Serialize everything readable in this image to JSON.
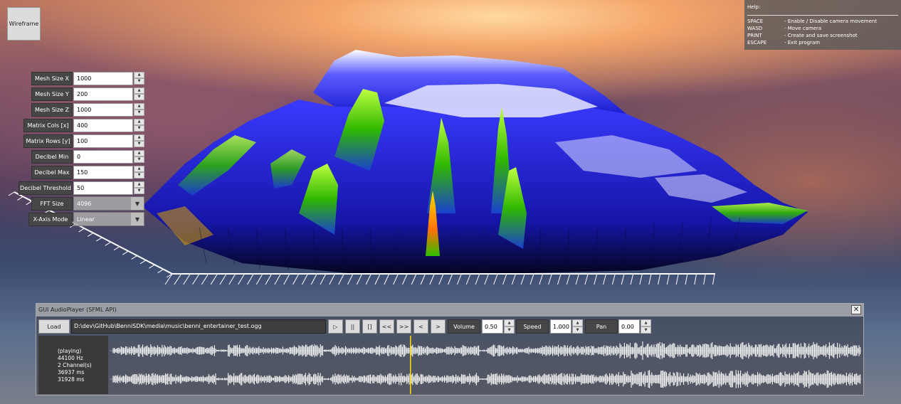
{
  "toolbar": {
    "wireframe_label": "Wireframe"
  },
  "help": {
    "title": "Help:",
    "items": [
      {
        "key": "SPACE",
        "desc": "- Enable / Disable camera movement"
      },
      {
        "key": "WASD",
        "desc": "- Move camera"
      },
      {
        "key": "PRINT",
        "desc": "- Create and save screenshot"
      },
      {
        "key": "ESCAPE",
        "desc": "- Exit program"
      }
    ]
  },
  "settings": {
    "mesh_x": {
      "label": "Mesh Size X",
      "value": "1000"
    },
    "mesh_y": {
      "label": "Mesh Size Y",
      "value": "200"
    },
    "mesh_z": {
      "label": "Mesh Size Z",
      "value": "1000"
    },
    "matrix_cols": {
      "label": "Matrix Cols [x]",
      "value": "400"
    },
    "matrix_rows": {
      "label": "Matrix Rows [y]",
      "value": "100"
    },
    "db_min": {
      "label": "Decibel Min",
      "value": "0"
    },
    "db_max": {
      "label": "Decibel Max",
      "value": "150"
    },
    "db_threshold": {
      "label": "Decibel Threshold",
      "value": "50"
    },
    "fft_size": {
      "label": "FFT Size",
      "value": "4096"
    },
    "x_axis_mode": {
      "label": "X-Axis Mode",
      "value": "Linear"
    }
  },
  "player": {
    "title": "GUI AudioPlayer (SFML API)",
    "close_label": "✕",
    "load_label": "Load",
    "path": "D:\\dev\\GitHub\\BenniSDK\\media\\music\\benni_entertainer_test.ogg",
    "controls": {
      "play": "▷",
      "pause": "||",
      "stop": "[]",
      "rewind": "<<",
      "forward": ">>",
      "prev": "<",
      "next": ">"
    },
    "volume": {
      "label": "Volume",
      "value": "0.50"
    },
    "speed": {
      "label": "Speed",
      "value": "1.000"
    },
    "pan": {
      "label": "Pan",
      "value": "0.00"
    },
    "status": {
      "state": "(playing)",
      "rate": "44100 Hz",
      "channels": "2 Channel(s)",
      "duration": "36937 ms",
      "position": "31928 ms"
    },
    "playhead_fraction": 0.4,
    "colors": {
      "waveform": "#ffffff",
      "playhead": "#ffe000"
    }
  },
  "colors": {
    "spectrum_low": "#1d1dff",
    "spectrum_mid": "#3fd000",
    "spectrum_high": "#ff9a00",
    "spectrum_peak": "#ffffff"
  }
}
